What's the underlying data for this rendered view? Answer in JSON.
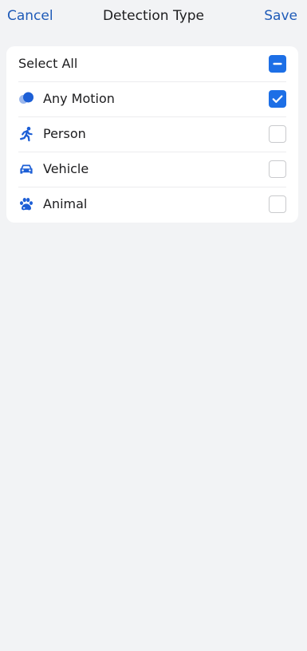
{
  "nav": {
    "cancel_label": "Cancel",
    "title": "Detection Type",
    "save_label": "Save"
  },
  "rows": [
    {
      "label": "Select All",
      "state": "indeterminate"
    },
    {
      "label": "Any Motion",
      "icon": "motion-icon",
      "state": "checked"
    },
    {
      "label": "Person",
      "icon": "person-running-icon",
      "state": "unchecked"
    },
    {
      "label": "Vehicle",
      "icon": "car-icon",
      "state": "unchecked"
    },
    {
      "label": "Animal",
      "icon": "paw-icon",
      "state": "unchecked"
    }
  ],
  "colors": {
    "accent": "#1d6fe6",
    "link": "#1f5bb8",
    "background": "#f2f3f5",
    "card": "#ffffff"
  }
}
